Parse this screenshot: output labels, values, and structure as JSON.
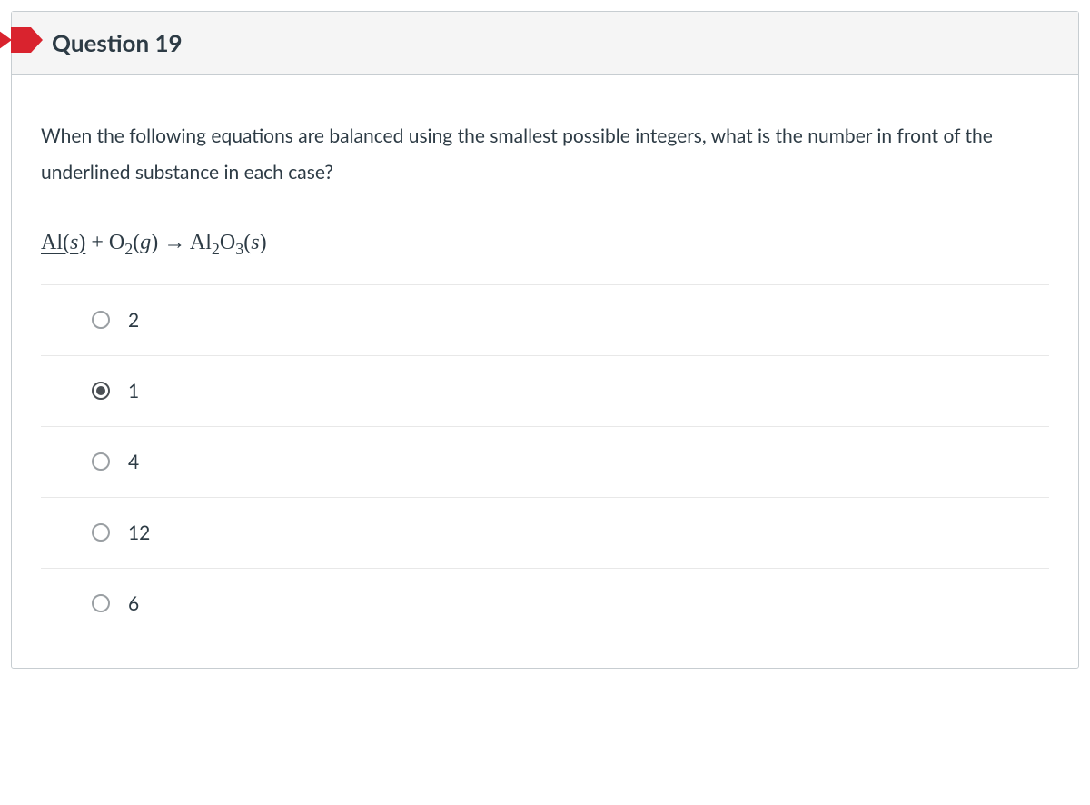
{
  "question": {
    "title": "Question 19",
    "prompt": "When the following equations are balanced using the smallest possible integers, what is the number in front of the underlined substance in each case?",
    "equation": {
      "underlined_species": "Al(s)",
      "rest": " + O₂(g) → Al₂O₃(s)"
    },
    "options": [
      {
        "label": "2",
        "selected": false
      },
      {
        "label": "1",
        "selected": true
      },
      {
        "label": "4",
        "selected": false
      },
      {
        "label": "12",
        "selected": false
      },
      {
        "label": "6",
        "selected": false
      }
    ]
  }
}
